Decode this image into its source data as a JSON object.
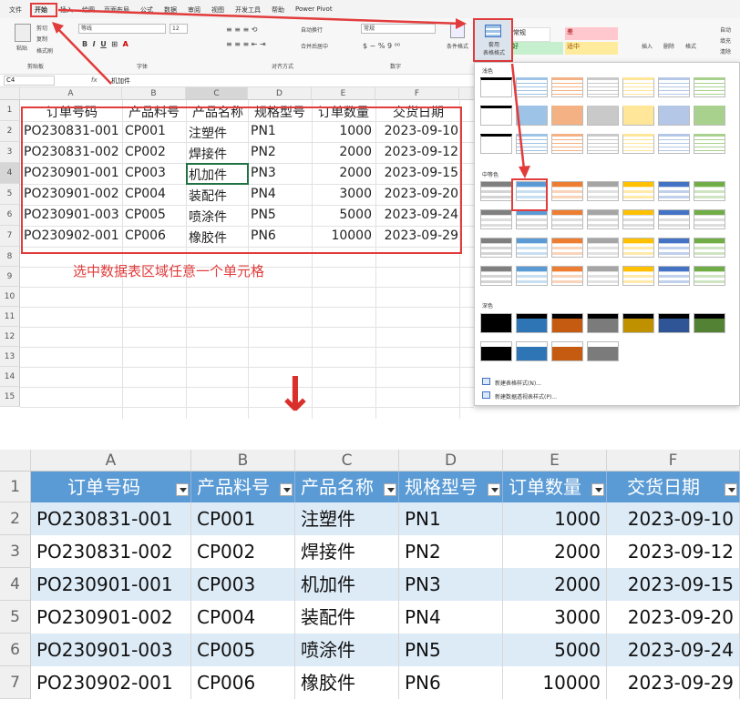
{
  "menu": [
    "文件",
    "开始",
    "插入",
    "绘图",
    "页面布局",
    "公式",
    "数据",
    "审阅",
    "视图",
    "开发工具",
    "帮助",
    "Power Pivot"
  ],
  "ribbon": {
    "cut": "剪切",
    "copy": "复制",
    "format_painter": "格式刷",
    "paste": "粘贴",
    "clipboard": "剪贴板",
    "font_name": "等线",
    "font_size": "12",
    "font_group": "字体",
    "wrap": "自动换行",
    "merge": "合并后居中",
    "align_group": "对齐方式",
    "num_format": "常规",
    "number_group": "数字",
    "cond_format": "条件格式",
    "table_format": "套用\n表格格式",
    "style_normal": "常规",
    "style_bad": "差",
    "style_good": "好",
    "style_neutral": "适中",
    "insert": "插入",
    "delete": "删除",
    "format": "格式",
    "autosum": "自动",
    "fill": "填充",
    "clear": "清除"
  },
  "formula_bar": {
    "name_box": "C4",
    "fx": "fx",
    "value": "机加件"
  },
  "columns": [
    "A",
    "B",
    "C",
    "D",
    "E",
    "F"
  ],
  "rows": [
    "1",
    "2",
    "3",
    "4",
    "5",
    "6",
    "7",
    "8",
    "9",
    "10",
    "11",
    "12",
    "13",
    "14",
    "15"
  ],
  "headers": [
    "订单号码",
    "产品料号",
    "产品名称",
    "规格型号",
    "订单数量",
    "交货日期"
  ],
  "table": [
    [
      "PO230831-001",
      "CP001",
      "注塑件",
      "PN1",
      "1000",
      "2023-09-10"
    ],
    [
      "PO230831-002",
      "CP002",
      "焊接件",
      "PN2",
      "2000",
      "2023-09-12"
    ],
    [
      "PO230901-001",
      "CP003",
      "机加件",
      "PN3",
      "2000",
      "2023-09-15"
    ],
    [
      "PO230901-002",
      "CP004",
      "装配件",
      "PN4",
      "3000",
      "2023-09-20"
    ],
    [
      "PO230901-003",
      "CP005",
      "喷涂件",
      "PN5",
      "5000",
      "2023-09-24"
    ],
    [
      "PO230902-001",
      "CP006",
      "橡胶件",
      "PN6",
      "10000",
      "2023-09-29"
    ]
  ],
  "annotation": "选中数据表区域任意一个单元格",
  "dropdown": {
    "light": "浅色",
    "medium": "中等色",
    "dark": "深色",
    "new_table_style": "新建表格样式(N)...",
    "new_pivot_style": "新建数据透视表样式(P)..."
  },
  "arrow_down": "↓",
  "colors": {
    "accent": "#e23b3b",
    "table_header": "#5b9bd5",
    "band": "#ddebf7"
  }
}
